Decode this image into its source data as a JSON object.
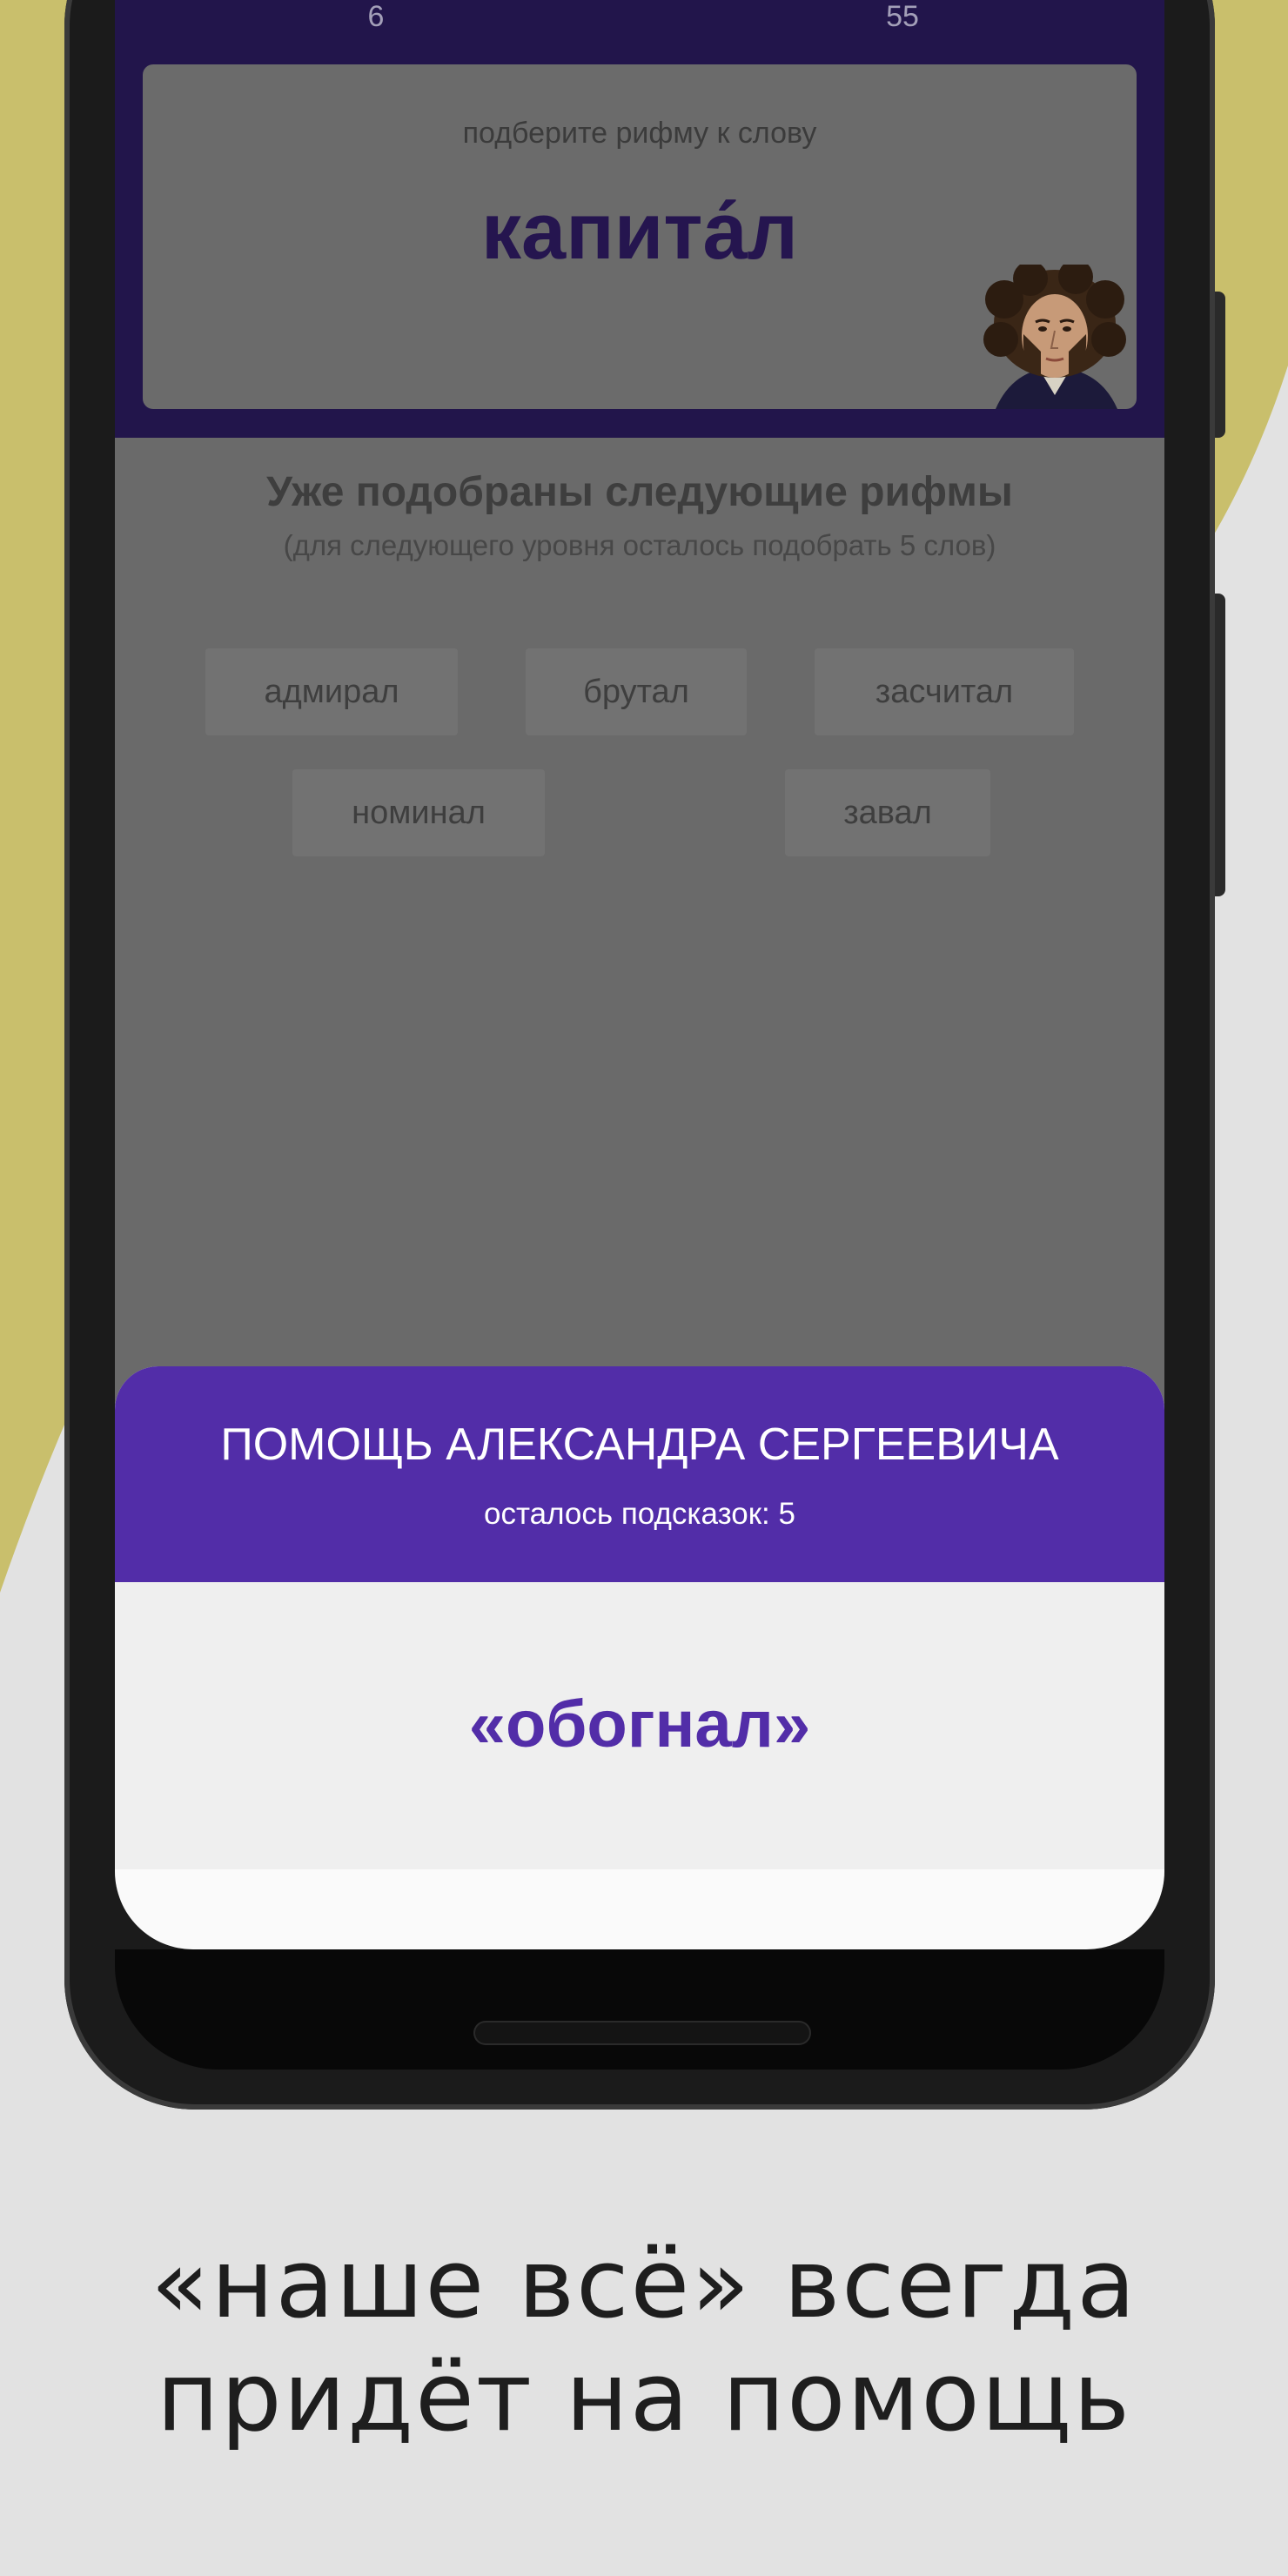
{
  "stats": {
    "left_value": "6",
    "right_value": "55"
  },
  "word_card": {
    "hint": "подберите рифму к слову",
    "word": "капита́л"
  },
  "rhymes": {
    "title": "Уже подобраны следующие рифмы",
    "subtitle": "(для следующего уровня осталось подобрать 5 слов)",
    "items": [
      "адмирал",
      "брутал",
      "засчитал",
      "номинал",
      "завал"
    ]
  },
  "help_sheet": {
    "title": "ПОМОЩЬ АЛЕКСАНДРА СЕРГЕЕВИЧА",
    "hints_left": "осталось подсказок: 5",
    "hint_word": "«обогнал»"
  },
  "caption": {
    "line1": "«наше всё» всегда",
    "line2": "придёт на помощь"
  },
  "colors": {
    "accent": "#522da8",
    "top_bar": "#22154b",
    "background_shape": "#c9bf6c",
    "background": "#e2e2e2"
  }
}
